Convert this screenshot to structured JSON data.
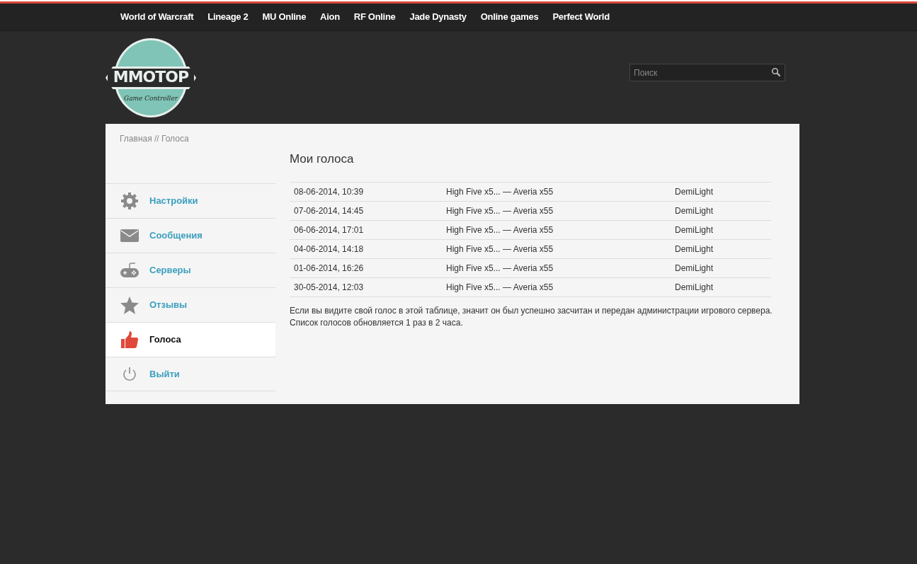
{
  "top_nav": [
    {
      "label": "World of Warcraft"
    },
    {
      "label": "Lineage 2"
    },
    {
      "label": "MU Online"
    },
    {
      "label": "Aion"
    },
    {
      "label": "RF Online"
    },
    {
      "label": "Jade Dynasty"
    },
    {
      "label": "Online games"
    },
    {
      "label": "Perfect World"
    }
  ],
  "logo": {
    "title": "MMOTOP",
    "subtitle": "Game Controller"
  },
  "search": {
    "placeholder": "Поиск"
  },
  "breadcrumb": "Главная // Голоса",
  "sidebar": {
    "items": [
      {
        "label": "Настройки",
        "kind": "gear",
        "selected": false
      },
      {
        "label": "Сообщения",
        "kind": "envelope",
        "selected": false
      },
      {
        "label": "Серверы",
        "kind": "gamepad",
        "selected": false
      },
      {
        "label": "Отзывы",
        "kind": "star",
        "selected": false
      },
      {
        "label": "Голоса",
        "kind": "thumb",
        "selected": true
      },
      {
        "label": "Выйти",
        "kind": "power",
        "selected": false
      }
    ]
  },
  "main": {
    "title": "Мои голоса",
    "table": {
      "rows": [
        [
          "08-06-2014, 10:39",
          "High Five x5... — Averia x55",
          "DemiLight"
        ],
        [
          "07-06-2014, 14:45",
          "High Five x5... — Averia x55",
          "DemiLight"
        ],
        [
          "06-06-2014, 17:01",
          "High Five x5... — Averia x55",
          "DemiLight"
        ],
        [
          "04-06-2014, 14:18",
          "High Five x5... — Averia x55",
          "DemiLight"
        ],
        [
          "01-06-2014, 16:26",
          "High Five x5... — Averia x55",
          "DemiLight"
        ],
        [
          "30-05-2014, 12:03",
          "High Five x5... — Averia x55",
          "DemiLight"
        ]
      ]
    },
    "note": "Если вы видите свой голос в этой таблице, значит он был успешно засчитан и передан администрации игрового сервера. Список голосов обновляется 1 раз в 2 часа."
  }
}
